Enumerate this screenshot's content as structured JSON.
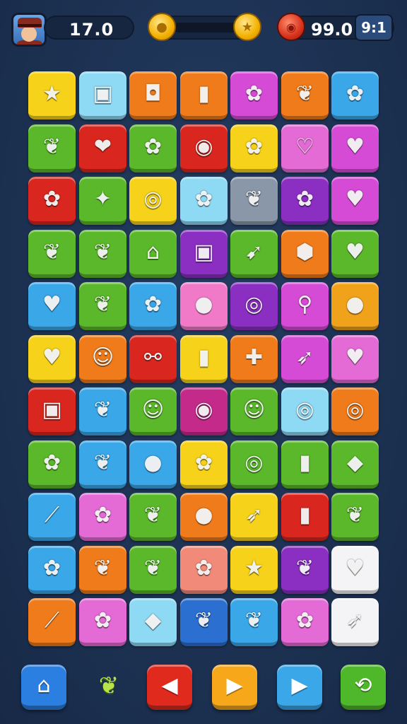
{
  "hud": {
    "score": "17.0",
    "coin_icon": "coin-icon",
    "star_icon": "star-coin-icon",
    "lives": "99.0",
    "level_badge": "9:1",
    "avatar_icon": "player-avatar"
  },
  "board": {
    "rows": 11,
    "cols": 7,
    "tiles": [
      [
        {
          "c": "#f6d21a",
          "g": "★"
        },
        {
          "c": "#8ed9f4",
          "g": "▣"
        },
        {
          "c": "#f07b1a",
          "g": "◘"
        },
        {
          "c": "#f07b1a",
          "g": "▮"
        },
        {
          "c": "#d64bd6",
          "g": "✿"
        },
        {
          "c": "#f07b1a",
          "g": "❦"
        },
        {
          "c": "#3aa7e8",
          "g": "✿"
        }
      ],
      [
        {
          "c": "#5ab82a",
          "g": "❦"
        },
        {
          "c": "#d9261e",
          "g": "❤"
        },
        {
          "c": "#5ab82a",
          "g": "✿"
        },
        {
          "c": "#d9261e",
          "g": "◉"
        },
        {
          "c": "#f6d21a",
          "g": "✿"
        },
        {
          "c": "#e46ad6",
          "g": "♡"
        },
        {
          "c": "#d64bd6",
          "g": "♥"
        }
      ],
      [
        {
          "c": "#d9261e",
          "g": "✿"
        },
        {
          "c": "#5ab82a",
          "g": "✦"
        },
        {
          "c": "#f6d21a",
          "g": "◎"
        },
        {
          "c": "#8ed9f4",
          "g": "✿"
        },
        {
          "c": "#8a97a8",
          "g": "❦"
        },
        {
          "c": "#8a2fc2",
          "g": "✿"
        },
        {
          "c": "#d64bd6",
          "g": "♥"
        }
      ],
      [
        {
          "c": "#5ab82a",
          "g": "❦"
        },
        {
          "c": "#5ab82a",
          "g": "❦"
        },
        {
          "c": "#5ab82a",
          "g": "⌂"
        },
        {
          "c": "#8a2fc2",
          "g": "▣"
        },
        {
          "c": "#5ab82a",
          "g": "➹"
        },
        {
          "c": "#f07b1a",
          "g": "⬢"
        },
        {
          "c": "#5ab82a",
          "g": "♥"
        }
      ],
      [
        {
          "c": "#3aa7e8",
          "g": "♥"
        },
        {
          "c": "#5ab82a",
          "g": "❦"
        },
        {
          "c": "#3aa7e8",
          "g": "✿"
        },
        {
          "c": "#f07ac8",
          "g": "●"
        },
        {
          "c": "#8a2fc2",
          "g": "◎"
        },
        {
          "c": "#d64bd6",
          "g": "⚲"
        },
        {
          "c": "#f0a21a",
          "g": "●"
        }
      ],
      [
        {
          "c": "#f6d21a",
          "g": "♥"
        },
        {
          "c": "#f07b1a",
          "g": "☺"
        },
        {
          "c": "#d9261e",
          "g": "⚯"
        },
        {
          "c": "#f6d21a",
          "g": "▮"
        },
        {
          "c": "#f07b1a",
          "g": "✚"
        },
        {
          "c": "#d64bd6",
          "g": "➶"
        },
        {
          "c": "#e46ad6",
          "g": "♥"
        }
      ],
      [
        {
          "c": "#d9261e",
          "g": "▣"
        },
        {
          "c": "#3aa7e8",
          "g": "❦"
        },
        {
          "c": "#5ab82a",
          "g": "☺"
        },
        {
          "c": "#c42a8a",
          "g": "◉"
        },
        {
          "c": "#5ab82a",
          "g": "☺"
        },
        {
          "c": "#8ed9f4",
          "g": "◎"
        },
        {
          "c": "#f07b1a",
          "g": "◎"
        }
      ],
      [
        {
          "c": "#5ab82a",
          "g": "✿"
        },
        {
          "c": "#3aa7e8",
          "g": "❦"
        },
        {
          "c": "#3aa7e8",
          "g": "●"
        },
        {
          "c": "#f6d21a",
          "g": "✿"
        },
        {
          "c": "#5ab82a",
          "g": "◎"
        },
        {
          "c": "#5ab82a",
          "g": "▮"
        },
        {
          "c": "#5ab82a",
          "g": "◆"
        }
      ],
      [
        {
          "c": "#3aa7e8",
          "g": "⟋"
        },
        {
          "c": "#e46ad6",
          "g": "✿"
        },
        {
          "c": "#5ab82a",
          "g": "❦"
        },
        {
          "c": "#f07b1a",
          "g": "●"
        },
        {
          "c": "#f6d21a",
          "g": "➶"
        },
        {
          "c": "#d9261e",
          "g": "▮"
        },
        {
          "c": "#5ab82a",
          "g": "❦"
        }
      ],
      [
        {
          "c": "#3aa7e8",
          "g": "✿"
        },
        {
          "c": "#f07b1a",
          "g": "❦"
        },
        {
          "c": "#5ab82a",
          "g": "❦"
        },
        {
          "c": "#f28a7a",
          "g": "✿"
        },
        {
          "c": "#f6d21a",
          "g": "★"
        },
        {
          "c": "#8a2fc2",
          "g": "❦"
        },
        {
          "c": "#f4f4f6",
          "g": "♥"
        }
      ],
      [
        {
          "c": "#f07b1a",
          "g": "⟋"
        },
        {
          "c": "#e46ad6",
          "g": "✿"
        },
        {
          "c": "#8ed9f4",
          "g": "◆"
        },
        {
          "c": "#2b6fd0",
          "g": "❦"
        },
        {
          "c": "#3aa7e8",
          "g": "❦"
        },
        {
          "c": "#e46ad6",
          "g": "✿"
        },
        {
          "c": "#f4f4f6",
          "g": "➶"
        }
      ]
    ]
  },
  "bottom": {
    "home_icon": "home-icon",
    "home_glyph": "⌂",
    "leaf_icon": "leaf-icon",
    "leaf_glyph": "❦",
    "back_icon": "arrow-left-icon",
    "back_glyph": "◀",
    "play_icon": "play-icon",
    "play_glyph": "▶",
    "next_icon": "play-icon",
    "next_glyph": "▶",
    "shuffle_icon": "shuffle-icon",
    "shuffle_glyph": "⟲",
    "colors": {
      "home": "#2b7fe0",
      "back": "#e02a1e",
      "play": "#f6a81a",
      "next": "#3aa7e8",
      "shuffle": "#4fb82a"
    }
  }
}
